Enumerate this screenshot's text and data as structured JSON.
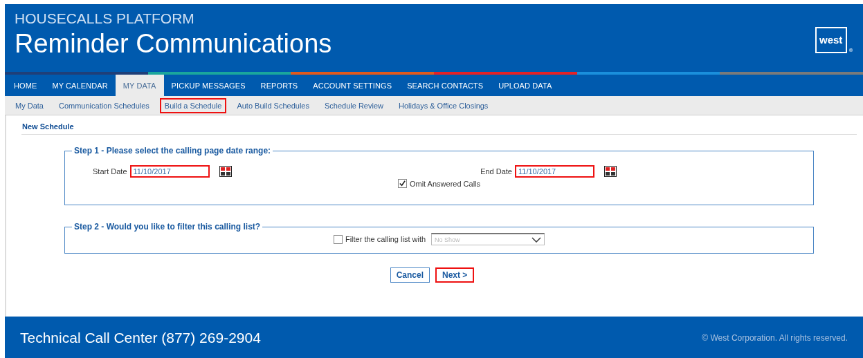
{
  "header": {
    "platform": "HOUSECALLS PLATFORM",
    "title": "Reminder Communications",
    "logo": {
      "text": "west",
      "mark": "®"
    }
  },
  "nav": [
    {
      "label": "HOME",
      "selected": false
    },
    {
      "label": "MY CALENDAR",
      "selected": false
    },
    {
      "label": "MY DATA",
      "selected": true
    },
    {
      "label": "PICKUP MESSAGES",
      "selected": false
    },
    {
      "label": "REPORTS",
      "selected": false
    },
    {
      "label": "ACCOUNT SETTINGS",
      "selected": false
    },
    {
      "label": "SEARCH CONTACTS",
      "selected": false
    },
    {
      "label": "UPLOAD DATA",
      "selected": false
    }
  ],
  "subnav": [
    {
      "label": "My Data",
      "highlighted": false
    },
    {
      "label": "Communication Schedules",
      "highlighted": false
    },
    {
      "label": "Build a Schedule",
      "highlighted": true
    },
    {
      "label": "Auto Build Schedules",
      "highlighted": false
    },
    {
      "label": "Schedule Review",
      "highlighted": false
    },
    {
      "label": "Holidays & Office Closings",
      "highlighted": false
    }
  ],
  "page_title": "New Schedule",
  "step1": {
    "legend": "Step 1 - Please select the calling page date range:",
    "start_date": {
      "label": "Start Date",
      "value": "11/10/2017",
      "highlighted": true
    },
    "end_date": {
      "label": "End Date",
      "value": "11/10/2017",
      "highlighted": true
    },
    "omit": {
      "label": "Omit Answered Calls",
      "checked": true
    }
  },
  "step2": {
    "legend": "Step 2 - Would you like to filter this calling list?",
    "filter": {
      "label": "Filter the calling list with",
      "checked": false
    },
    "select": {
      "value": "No Show",
      "disabled": true
    }
  },
  "buttons": [
    {
      "label": "Cancel",
      "highlighted": false
    },
    {
      "label": "Next >",
      "highlighted": true
    }
  ],
  "footer": {
    "contact": "Technical Call Center (877) 269-2904",
    "copyright": "© West Corporation. All rights reserved."
  }
}
